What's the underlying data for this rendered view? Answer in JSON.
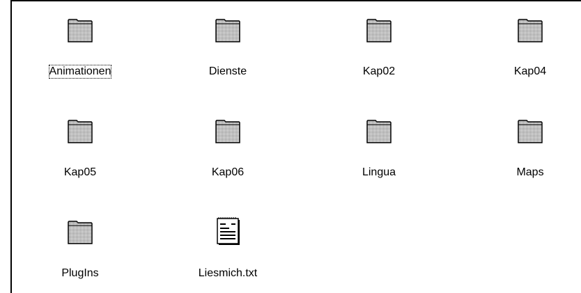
{
  "files": [
    {
      "name": "Animationen",
      "icon": "folder-icon",
      "focused": true
    },
    {
      "name": "Dienste",
      "icon": "folder-icon"
    },
    {
      "name": "Kap02",
      "icon": "folder-icon"
    },
    {
      "name": "Kap04",
      "icon": "folder-icon"
    },
    {
      "name": "Kap05",
      "icon": "folder-icon"
    },
    {
      "name": "Kap06",
      "icon": "folder-icon"
    },
    {
      "name": "Lingua",
      "icon": "folder-icon"
    },
    {
      "name": "Maps",
      "icon": "folder-icon"
    },
    {
      "name": "PlugIns",
      "icon": "folder-icon"
    },
    {
      "name": "Liesmich.txt",
      "icon": "text-document-icon"
    }
  ]
}
